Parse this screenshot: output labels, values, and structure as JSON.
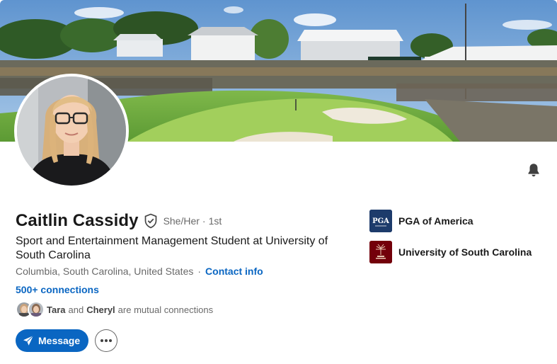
{
  "profile": {
    "name": "Caitlin Cassidy",
    "pronouns": "She/Her",
    "separator": "·",
    "degree": "1st",
    "headline": "Sport and Entertainment Management Student at University of South Carolina",
    "location": "Columbia, South Carolina, United States",
    "location_sep": "·",
    "contact_label": "Contact info",
    "connections_label": "500+ connections"
  },
  "mutual": {
    "first": "Tara",
    "joiner": "and",
    "second": "Cheryl",
    "suffix": "are mutual connections"
  },
  "actions": {
    "message_label": "Message"
  },
  "organizations": [
    {
      "name": "PGA of America",
      "logo_text": "PGA",
      "logo_color": "#1d3b6b",
      "icon": "pga-logo-icon"
    },
    {
      "name": "University of South Carolina",
      "logo_color": "#73000a",
      "icon": "usc-logo-icon"
    }
  ],
  "colors": {
    "accent": "#0a66c2",
    "pga": "#1d3b6b",
    "usc": "#73000a"
  },
  "icons": {
    "verified": "shield-check-icon",
    "bell": "bell-icon",
    "message": "paper-plane-icon",
    "more": "ellipsis-icon"
  }
}
